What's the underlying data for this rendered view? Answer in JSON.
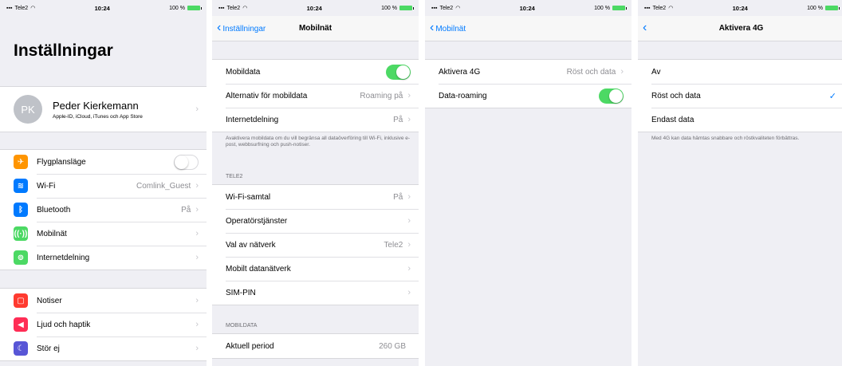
{
  "status": {
    "carrier": "Tele2",
    "time": "10:24",
    "battery": "100 %"
  },
  "screen1": {
    "title": "Inställningar",
    "profile": {
      "initials": "PK",
      "name": "Peder Kierkemann",
      "sub": "Apple-ID, iCloud, iTunes och App Store"
    },
    "group1": [
      {
        "label": "Flygplansläge",
        "value": "",
        "icon": "airplane-icon",
        "color": "#ff9500"
      },
      {
        "label": "Wi-Fi",
        "value": "Comlink_Guest",
        "icon": "wifi-icon",
        "color": "#007aff"
      },
      {
        "label": "Bluetooth",
        "value": "På",
        "icon": "bluetooth-icon",
        "color": "#007aff"
      },
      {
        "label": "Mobilnät",
        "value": "",
        "icon": "cellular-icon",
        "color": "#4cd964"
      },
      {
        "label": "Internetdelning",
        "value": "",
        "icon": "hotspot-icon",
        "color": "#4cd964"
      }
    ],
    "group2": [
      {
        "label": "Notiser",
        "icon": "notifications-icon",
        "color": "#ff3b30"
      },
      {
        "label": "Ljud och haptik",
        "icon": "sound-icon",
        "color": "#ff2d55"
      },
      {
        "label": "Stör ej",
        "icon": "moon-icon",
        "color": "#5856d6"
      }
    ]
  },
  "screen2": {
    "back": "Inställningar",
    "title": "Mobilnät",
    "rows1": [
      {
        "label": "Mobildata",
        "value": ""
      },
      {
        "label": "Alternativ för mobildata",
        "value": "Roaming på"
      },
      {
        "label": "Internetdelning",
        "value": "På"
      }
    ],
    "note": "Avaktivera mobildata om du vill begränsa all dataöverföring till Wi-Fi, inklusive e-post, webbsurfning och push-notiser.",
    "section": "TELE2",
    "rows2": [
      {
        "label": "Wi-Fi-samtal",
        "value": "På"
      },
      {
        "label": "Operatörstjänster",
        "value": ""
      },
      {
        "label": "Val av nätverk",
        "value": "Tele2"
      },
      {
        "label": "Mobilt datanätverk",
        "value": ""
      },
      {
        "label": "SIM-PIN",
        "value": ""
      }
    ],
    "section2": "MOBILDATA",
    "period_label": "Aktuell period",
    "period_value": "260 GB"
  },
  "screen3": {
    "back": "Mobilnät",
    "rows": [
      {
        "label": "Aktivera 4G",
        "value": "Röst och data"
      },
      {
        "label": "Data-roaming",
        "value": ""
      }
    ]
  },
  "screen4": {
    "title": "Aktivera 4G",
    "options": [
      "Av",
      "Röst och data",
      "Endast data"
    ],
    "note": "Med 4G kan data hämtas snabbare och röstkvaliteten förbättras."
  }
}
